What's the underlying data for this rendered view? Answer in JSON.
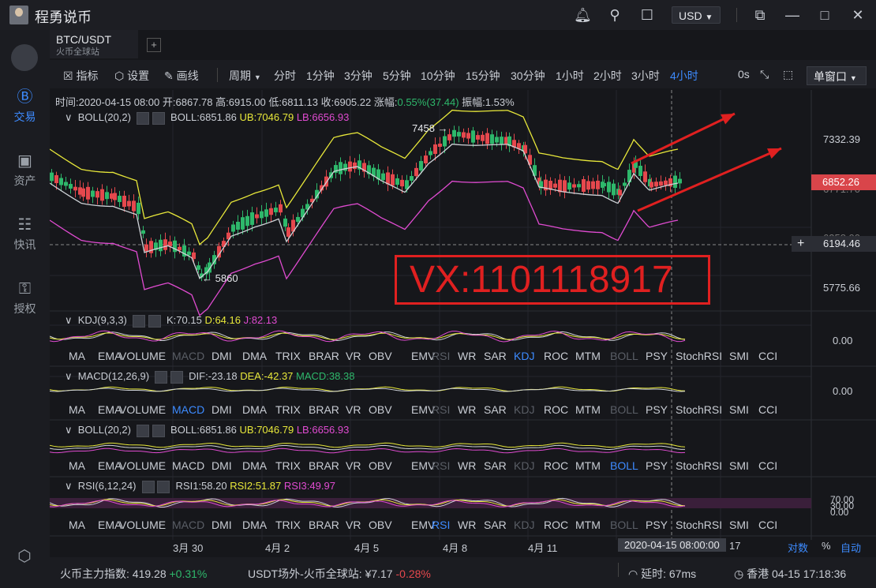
{
  "app": {
    "title": "程勇说币",
    "currency": "USD"
  },
  "sidebar": {
    "items": [
      {
        "label": "交易",
        "icon": "trade-icon",
        "active": true
      },
      {
        "label": "资产",
        "icon": "wallet-icon"
      },
      {
        "label": "快讯",
        "icon": "news-icon"
      },
      {
        "label": "授权",
        "icon": "auth-icon"
      }
    ]
  },
  "tab": {
    "pair": "BTC/USDT",
    "exchange": "火币全球站"
  },
  "toolbar": {
    "indicator": "指标",
    "settings": "设置",
    "draw": "画线",
    "period_label": "周期",
    "periods": [
      "分时",
      "1分钟",
      "3分钟",
      "5分钟",
      "10分钟",
      "15分钟",
      "30分钟",
      "1小时",
      "2小时",
      "3小时",
      "4小时"
    ],
    "active_period": "4小时",
    "zero_s": "0s",
    "window": "单窗口"
  },
  "ohlc": {
    "time": "时间:2020-04-15 08:00",
    "open": "开:6867.78",
    "high": "高:6915.00",
    "low": "低:6811.13",
    "close": "收:6905.22",
    "change_label": "涨幅:",
    "change": "0.55%(37.44)",
    "amplitude": "振幅:1.53%"
  },
  "main_indicator": {
    "name": "BOLL(20,2)",
    "boll": "BOLL:6851.86",
    "ub": "UB:7046.79",
    "lb": "LB:6656.93"
  },
  "price_axis": [
    "7332.39",
    "6771.70",
    "6358.00",
    "5775.66"
  ],
  "price_tag": "6852.26",
  "crosshair_price": "6194.46",
  "annotations": {
    "high": "7458",
    "low": "5860",
    "watermark": "VX:1101118917"
  },
  "colors": {
    "up": "#2eb86b",
    "down": "#e5484d",
    "boll_mid": "#cfd3d8",
    "ub": "#e8e83a",
    "lb": "#e04bd1",
    "accent": "#3d8bff",
    "watermark": "#e02020"
  },
  "panels": [
    {
      "name": "KDJ(9,3,3)",
      "v1": "K:70.15",
      "v2": "D:64.16",
      "v3": "J:82.13",
      "axis": "0.00",
      "selected": "KDJ",
      "dimmed": [
        "MACD",
        "RSI",
        "BOLL"
      ]
    },
    {
      "name": "MACD(12,26,9)",
      "v1": "DIF:-23.18",
      "v2": "DEA:-42.37",
      "v3": "MACD:38.38",
      "axis": "0.00",
      "selected": "MACD",
      "dimmed": [
        "RSI",
        "KDJ",
        "BOLL"
      ]
    },
    {
      "name": "BOLL(20,2)",
      "v1": "BOLL:6851.86",
      "v2": "UB:7046.79",
      "v3": "LB:6656.93",
      "axis": "",
      "selected": "BOLL",
      "dimmed": [
        "RSI",
        "KDJ"
      ]
    },
    {
      "name": "RSI(6,12,24)",
      "v1": "RSI1:58.20",
      "v2": "RSI2:51.87",
      "v3": "RSI3:49.97",
      "axis": "70.00",
      "axis2": "30.00",
      "axis3": "0.00",
      "selected": "RSI",
      "dimmed": [
        "MACD",
        "KDJ",
        "BOLL"
      ]
    }
  ],
  "indicator_tabs": [
    "MA",
    "EMA",
    "VOLUME",
    "MACD",
    "DMI",
    "DMA",
    "TRIX",
    "BRAR",
    "VR",
    "OBV",
    "EMV",
    "RSI",
    "WR",
    "SAR",
    "KDJ",
    "ROC",
    "MTM",
    "BOLL",
    "PSY",
    "StochRSI",
    "SMI",
    "CCI"
  ],
  "date_axis": [
    "3月 30",
    "4月 2",
    "4月 5",
    "4月 8",
    "4月 11",
    "2020-04-15 08:00:00",
    "17"
  ],
  "axis_mode": {
    "log": "对数",
    "pct": "%",
    "auto": "自动"
  },
  "status": {
    "index_label": "火币主力指数:",
    "index_value": "419.28",
    "index_change": "+0.31%",
    "otc_label": "USDT场外-火币全球站:",
    "otc_value": "¥7.17",
    "otc_change": "-0.28%",
    "latency_label": "延时:",
    "latency": "67ms",
    "clock": "香港 04-15 17:18:36"
  }
}
